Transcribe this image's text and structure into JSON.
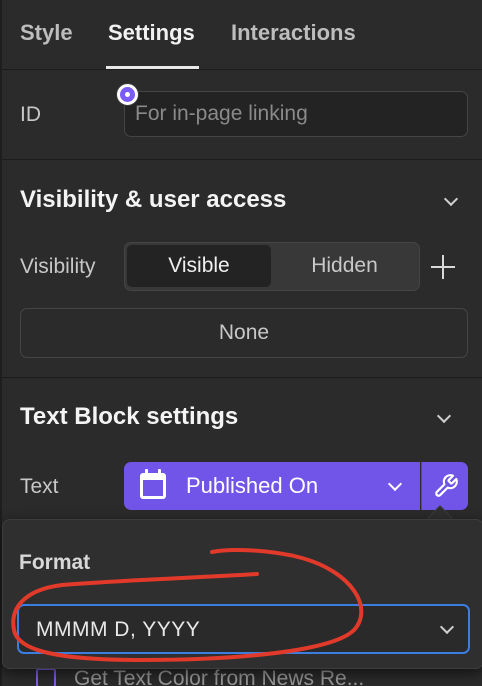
{
  "tabs": {
    "style": "Style",
    "settings": "Settings",
    "interactions": "Interactions"
  },
  "id_field": {
    "label": "ID",
    "placeholder": "For in-page linking"
  },
  "visibility_section": {
    "title": "Visibility & user access",
    "visibility_label": "Visibility",
    "options": [
      "Visible",
      "Hidden"
    ],
    "selected": "Visible",
    "access_button": "None"
  },
  "text_block_section": {
    "title": "Text Block settings",
    "text_label": "Text",
    "binding_value": "Published On",
    "binding_icon": "calendar-icon",
    "settings_icon": "wrench-icon"
  },
  "format_popover": {
    "title": "Format",
    "selected_format": "MMMM D, YYYY"
  },
  "background_row": {
    "text": "Get Text Color from  News Re..."
  },
  "colors": {
    "accent_purple": "#7155e8",
    "focus_blue": "#3b7de0",
    "annotation_red": "#e23a2a"
  }
}
